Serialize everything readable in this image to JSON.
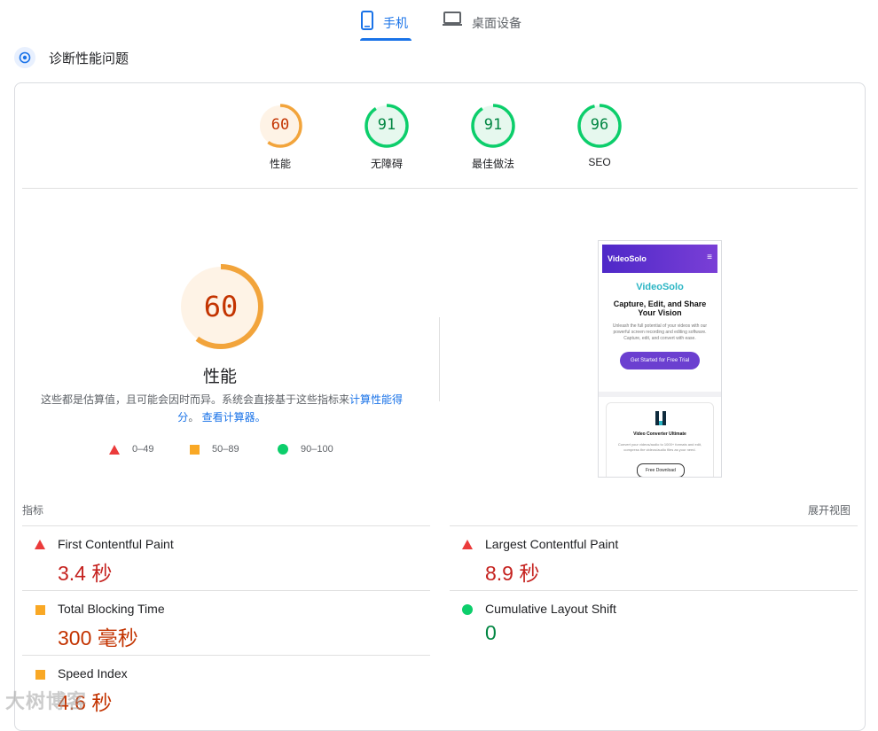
{
  "tabs": {
    "mobile": "手机",
    "desktop": "桌面设备"
  },
  "diagnose_title": "诊断性能问题",
  "scores": [
    {
      "value": "60",
      "label": "性能",
      "status": "average",
      "color": "#f2a43b"
    },
    {
      "value": "91",
      "label": "无障碍",
      "status": "pass",
      "color": "#0cce6b"
    },
    {
      "value": "91",
      "label": "最佳做法",
      "status": "pass",
      "color": "#0cce6b"
    },
    {
      "value": "96",
      "label": "SEO",
      "status": "pass",
      "color": "#0cce6b"
    }
  ],
  "perf": {
    "score": "60",
    "title": "性能",
    "desc_prefix": "这些都是估算值，且可能会因时而异。系统会直接基于这些指标来",
    "desc_link1": "计算性能得分",
    "desc_mid": "。",
    "desc_link2": "查看计算器。"
  },
  "legend": {
    "fail": "0–49",
    "average": "50–89",
    "pass": "90–100"
  },
  "preview": {
    "logo": "VideoSolo",
    "menu": "≡",
    "brand": "VideoSolo",
    "headline": "Capture, Edit, and Share Your Vision",
    "text": "Unleash the full potential of your videos with our powerful screen recording and editing software. Capture, edit, and convert with ease.",
    "cta": "Get Started for Free Trial",
    "card_title": "Video Converter Ultimate",
    "card_text": "Convert your videos/audio to 1000+ formats and edit, compress the videos/audio files as your need.",
    "card_cta": "Free Download"
  },
  "metrics": {
    "heading": "指标",
    "expand": "展开视图",
    "fcp": {
      "name": "First Contentful Paint",
      "value": "3.4 秒",
      "status": "fail"
    },
    "lcp": {
      "name": "Largest Contentful Paint",
      "value": "8.9 秒",
      "status": "fail"
    },
    "tbt": {
      "name": "Total Blocking Time",
      "value": "300 毫秒",
      "status": "average"
    },
    "cls": {
      "name": "Cumulative Layout Shift",
      "value": "0",
      "status": "pass"
    },
    "si": {
      "name": "Speed Index",
      "value": "4.6 秒",
      "status": "average"
    }
  },
  "colors": {
    "fail": "#eb3b3b",
    "average": "#f9a825",
    "pass": "#0cce6b",
    "link": "#1a73e8"
  },
  "watermark": "大树博客"
}
